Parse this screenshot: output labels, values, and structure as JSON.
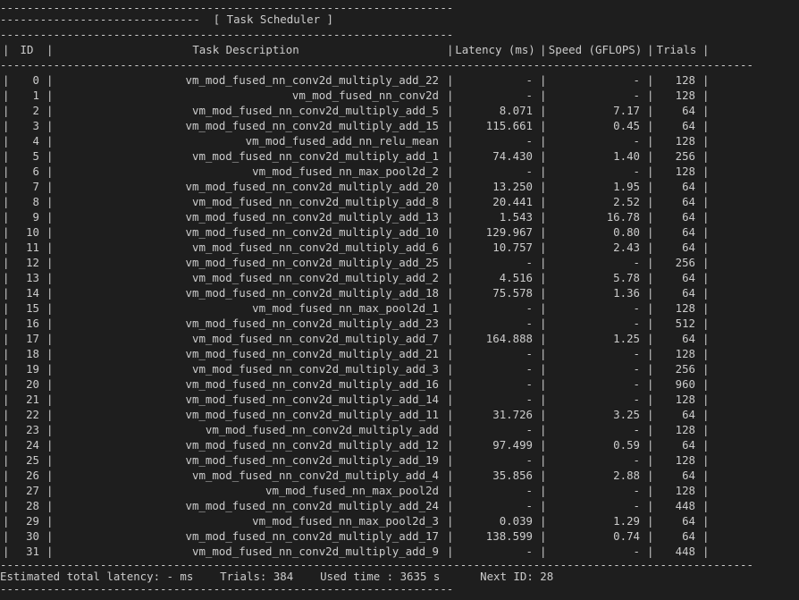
{
  "title_line": "------------------------------  [ Task Scheduler ]",
  "dash_short": "--------------------------------------------------------------------",
  "dash_long": "-------------------------------------------------------------------------------------------------------------------------",
  "header": {
    "id": "ID",
    "description": "Task Description",
    "latency": "Latency (ms)",
    "speed": "Speed (GFLOPS)",
    "trials": "Trials"
  },
  "rows": [
    {
      "id": "0",
      "desc": "vm_mod_fused_nn_conv2d_multiply_add_22",
      "latency": "-",
      "speed": "-",
      "trials": "128"
    },
    {
      "id": "1",
      "desc": "vm_mod_fused_nn_conv2d",
      "latency": "-",
      "speed": "-",
      "trials": "128"
    },
    {
      "id": "2",
      "desc": "vm_mod_fused_nn_conv2d_multiply_add_5",
      "latency": "8.071",
      "speed": "7.17",
      "trials": "64"
    },
    {
      "id": "3",
      "desc": "vm_mod_fused_nn_conv2d_multiply_add_15",
      "latency": "115.661",
      "speed": "0.45",
      "trials": "64"
    },
    {
      "id": "4",
      "desc": "vm_mod_fused_add_nn_relu_mean",
      "latency": "-",
      "speed": "-",
      "trials": "128"
    },
    {
      "id": "5",
      "desc": "vm_mod_fused_nn_conv2d_multiply_add_1",
      "latency": "74.430",
      "speed": "1.40",
      "trials": "256"
    },
    {
      "id": "6",
      "desc": "vm_mod_fused_nn_max_pool2d_2",
      "latency": "-",
      "speed": "-",
      "trials": "128"
    },
    {
      "id": "7",
      "desc": "vm_mod_fused_nn_conv2d_multiply_add_20",
      "latency": "13.250",
      "speed": "1.95",
      "trials": "64"
    },
    {
      "id": "8",
      "desc": "vm_mod_fused_nn_conv2d_multiply_add_8",
      "latency": "20.441",
      "speed": "2.52",
      "trials": "64"
    },
    {
      "id": "9",
      "desc": "vm_mod_fused_nn_conv2d_multiply_add_13",
      "latency": "1.543",
      "speed": "16.78",
      "trials": "64"
    },
    {
      "id": "10",
      "desc": "vm_mod_fused_nn_conv2d_multiply_add_10",
      "latency": "129.967",
      "speed": "0.80",
      "trials": "64"
    },
    {
      "id": "11",
      "desc": "vm_mod_fused_nn_conv2d_multiply_add_6",
      "latency": "10.757",
      "speed": "2.43",
      "trials": "64"
    },
    {
      "id": "12",
      "desc": "vm_mod_fused_nn_conv2d_multiply_add_25",
      "latency": "-",
      "speed": "-",
      "trials": "256"
    },
    {
      "id": "13",
      "desc": "vm_mod_fused_nn_conv2d_multiply_add_2",
      "latency": "4.516",
      "speed": "5.78",
      "trials": "64"
    },
    {
      "id": "14",
      "desc": "vm_mod_fused_nn_conv2d_multiply_add_18",
      "latency": "75.578",
      "speed": "1.36",
      "trials": "64"
    },
    {
      "id": "15",
      "desc": "vm_mod_fused_nn_max_pool2d_1",
      "latency": "-",
      "speed": "-",
      "trials": "128"
    },
    {
      "id": "16",
      "desc": "vm_mod_fused_nn_conv2d_multiply_add_23",
      "latency": "-",
      "speed": "-",
      "trials": "512"
    },
    {
      "id": "17",
      "desc": "vm_mod_fused_nn_conv2d_multiply_add_7",
      "latency": "164.888",
      "speed": "1.25",
      "trials": "64"
    },
    {
      "id": "18",
      "desc": "vm_mod_fused_nn_conv2d_multiply_add_21",
      "latency": "-",
      "speed": "-",
      "trials": "128"
    },
    {
      "id": "19",
      "desc": "vm_mod_fused_nn_conv2d_multiply_add_3",
      "latency": "-",
      "speed": "-",
      "trials": "256"
    },
    {
      "id": "20",
      "desc": "vm_mod_fused_nn_conv2d_multiply_add_16",
      "latency": "-",
      "speed": "-",
      "trials": "960"
    },
    {
      "id": "21",
      "desc": "vm_mod_fused_nn_conv2d_multiply_add_14",
      "latency": "-",
      "speed": "-",
      "trials": "128"
    },
    {
      "id": "22",
      "desc": "vm_mod_fused_nn_conv2d_multiply_add_11",
      "latency": "31.726",
      "speed": "3.25",
      "trials": "64"
    },
    {
      "id": "23",
      "desc": "vm_mod_fused_nn_conv2d_multiply_add",
      "latency": "-",
      "speed": "-",
      "trials": "128"
    },
    {
      "id": "24",
      "desc": "vm_mod_fused_nn_conv2d_multiply_add_12",
      "latency": "97.499",
      "speed": "0.59",
      "trials": "64"
    },
    {
      "id": "25",
      "desc": "vm_mod_fused_nn_conv2d_multiply_add_19",
      "latency": "-",
      "speed": "-",
      "trials": "128"
    },
    {
      "id": "26",
      "desc": "vm_mod_fused_nn_conv2d_multiply_add_4",
      "latency": "35.856",
      "speed": "2.88",
      "trials": "64"
    },
    {
      "id": "27",
      "desc": "vm_mod_fused_nn_max_pool2d",
      "latency": "-",
      "speed": "-",
      "trials": "128"
    },
    {
      "id": "28",
      "desc": "vm_mod_fused_nn_conv2d_multiply_add_24",
      "latency": "-",
      "speed": "-",
      "trials": "448"
    },
    {
      "id": "29",
      "desc": "vm_mod_fused_nn_max_pool2d_3",
      "latency": "0.039",
      "speed": "1.29",
      "trials": "64"
    },
    {
      "id": "30",
      "desc": "vm_mod_fused_nn_conv2d_multiply_add_17",
      "latency": "138.599",
      "speed": "0.74",
      "trials": "64"
    },
    {
      "id": "31",
      "desc": "vm_mod_fused_nn_conv2d_multiply_add_9",
      "latency": "-",
      "speed": "-",
      "trials": "448"
    }
  ],
  "footer": "Estimated total latency: - ms    Trials: 384    Used time : 3635 s      Next ID: 28",
  "colors": {
    "background": "#1e1e1e",
    "text": "#cccccc"
  }
}
